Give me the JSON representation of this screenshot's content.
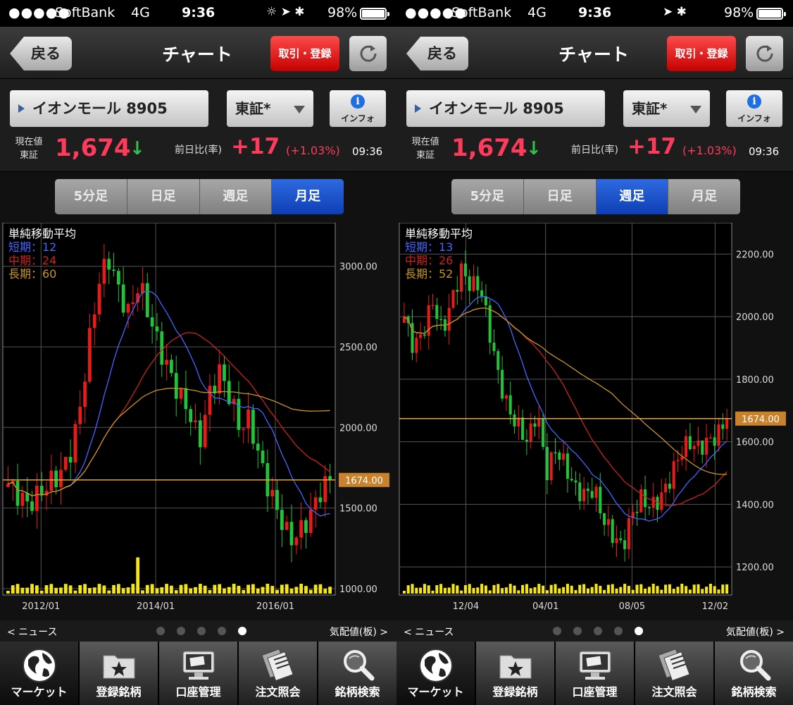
{
  "screens": [
    {
      "status": {
        "signal": "●●●●●",
        "carrier": "SoftBank",
        "network": "4G",
        "time": "9:36",
        "icons": "☼ ➤ ✱",
        "battery": "98%"
      },
      "nav": {
        "back_label": "戻る",
        "title": "チャート",
        "trade_label": "取引・登録"
      },
      "stock": {
        "name": "イオンモール 8905",
        "market": "東証*",
        "info_label": "インフォ",
        "info_icon": "i",
        "price_label_1": "現在値",
        "price_label_2": "東証",
        "price": "1,674",
        "price_arrow": "↓",
        "change_label": "前日比(率)",
        "change": "+17",
        "change_pct": "(+1.03%)",
        "time": "09:36"
      },
      "tabs": [
        {
          "label": "5分足",
          "active": false
        },
        {
          "label": "日足",
          "active": false
        },
        {
          "label": "週足",
          "active": false
        },
        {
          "label": "月足",
          "active": true
        }
      ],
      "legend": {
        "title": "単純移動平均",
        "short": "短期：12",
        "mid": "中期：24",
        "long": "長期：60"
      },
      "chart_data": {
        "type": "candlestick",
        "title": "",
        "interval": "月足",
        "x_tick_labels": [
          "2012/01",
          "2014/01",
          "2016/01"
        ],
        "y_tick_labels": [
          "3000.00",
          "2500.00",
          "2000.00",
          "1500.00",
          "1000.00"
        ],
        "y_ticks": [
          3000,
          2500,
          2000,
          1500,
          1000
        ],
        "ylim": [
          960,
          3270
        ],
        "current_price": 1674,
        "current_price_label": "1674.00",
        "moving_averages": [
          {
            "name": "短期",
            "period": 12,
            "color": "#4466ff"
          },
          {
            "name": "中期",
            "period": 24,
            "color": "#cc2222"
          },
          {
            "name": "長期",
            "period": 60,
            "color": "#c8961e"
          }
        ],
        "grid": true,
        "up_color": "#e81a1a",
        "down_color": "#22c23b",
        "volume_color": "#f5e61a"
      }
    },
    {
      "status": {
        "signal": "●●●●●",
        "carrier": "SoftBank",
        "network": "4G",
        "time": "9:36",
        "icons": "➤ ✱",
        "battery": "98%"
      },
      "nav": {
        "back_label": "戻る",
        "title": "チャート",
        "trade_label": "取引・登録"
      },
      "stock": {
        "name": "イオンモール 8905",
        "market": "東証*",
        "info_label": "インフォ",
        "info_icon": "i",
        "price_label_1": "現在値",
        "price_label_2": "東証",
        "price": "1,674",
        "price_arrow": "↓",
        "change_label": "前日比(率)",
        "change": "+17",
        "change_pct": "(+1.03%)",
        "time": "09:36"
      },
      "tabs": [
        {
          "label": "5分足",
          "active": false
        },
        {
          "label": "日足",
          "active": false
        },
        {
          "label": "週足",
          "active": true
        },
        {
          "label": "月足",
          "active": false
        }
      ],
      "legend": {
        "title": "単純移動平均",
        "short": "短期：13",
        "mid": "中期：26",
        "long": "長期：52"
      },
      "chart_data": {
        "type": "candlestick",
        "title": "",
        "interval": "週足",
        "x_tick_labels": [
          "12/04",
          "04/01",
          "08/05",
          "12/02"
        ],
        "y_tick_labels": [
          "2200.00",
          "2000.00",
          "1800.00",
          "1600.00",
          "1400.00",
          "1200.00"
        ],
        "y_ticks": [
          2200,
          2000,
          1800,
          1600,
          1400,
          1200
        ],
        "ylim": [
          1110,
          2300
        ],
        "current_price": 1674,
        "current_price_label": "1674.00",
        "moving_averages": [
          {
            "name": "短期",
            "period": 13,
            "color": "#4466ff"
          },
          {
            "name": "中期",
            "period": 26,
            "color": "#cc2222"
          },
          {
            "name": "長期",
            "period": 52,
            "color": "#c8961e"
          }
        ],
        "grid": true,
        "up_color": "#e81a1a",
        "down_color": "#22c23b",
        "volume_color": "#f5e61a"
      }
    }
  ],
  "pager": {
    "news": "< ニュース",
    "board": "気配値(板) >",
    "pages": 5,
    "active_page": 5
  },
  "tabbar": [
    {
      "label": "マーケット",
      "icon": "globe-icon",
      "active": true
    },
    {
      "label": "登録銘柄",
      "icon": "star-folder-icon",
      "active": false
    },
    {
      "label": "口座管理",
      "icon": "monitor-icon",
      "active": false
    },
    {
      "label": "注文照会",
      "icon": "documents-icon",
      "active": false
    },
    {
      "label": "銘柄検索",
      "icon": "magnifier-icon",
      "active": false
    }
  ]
}
